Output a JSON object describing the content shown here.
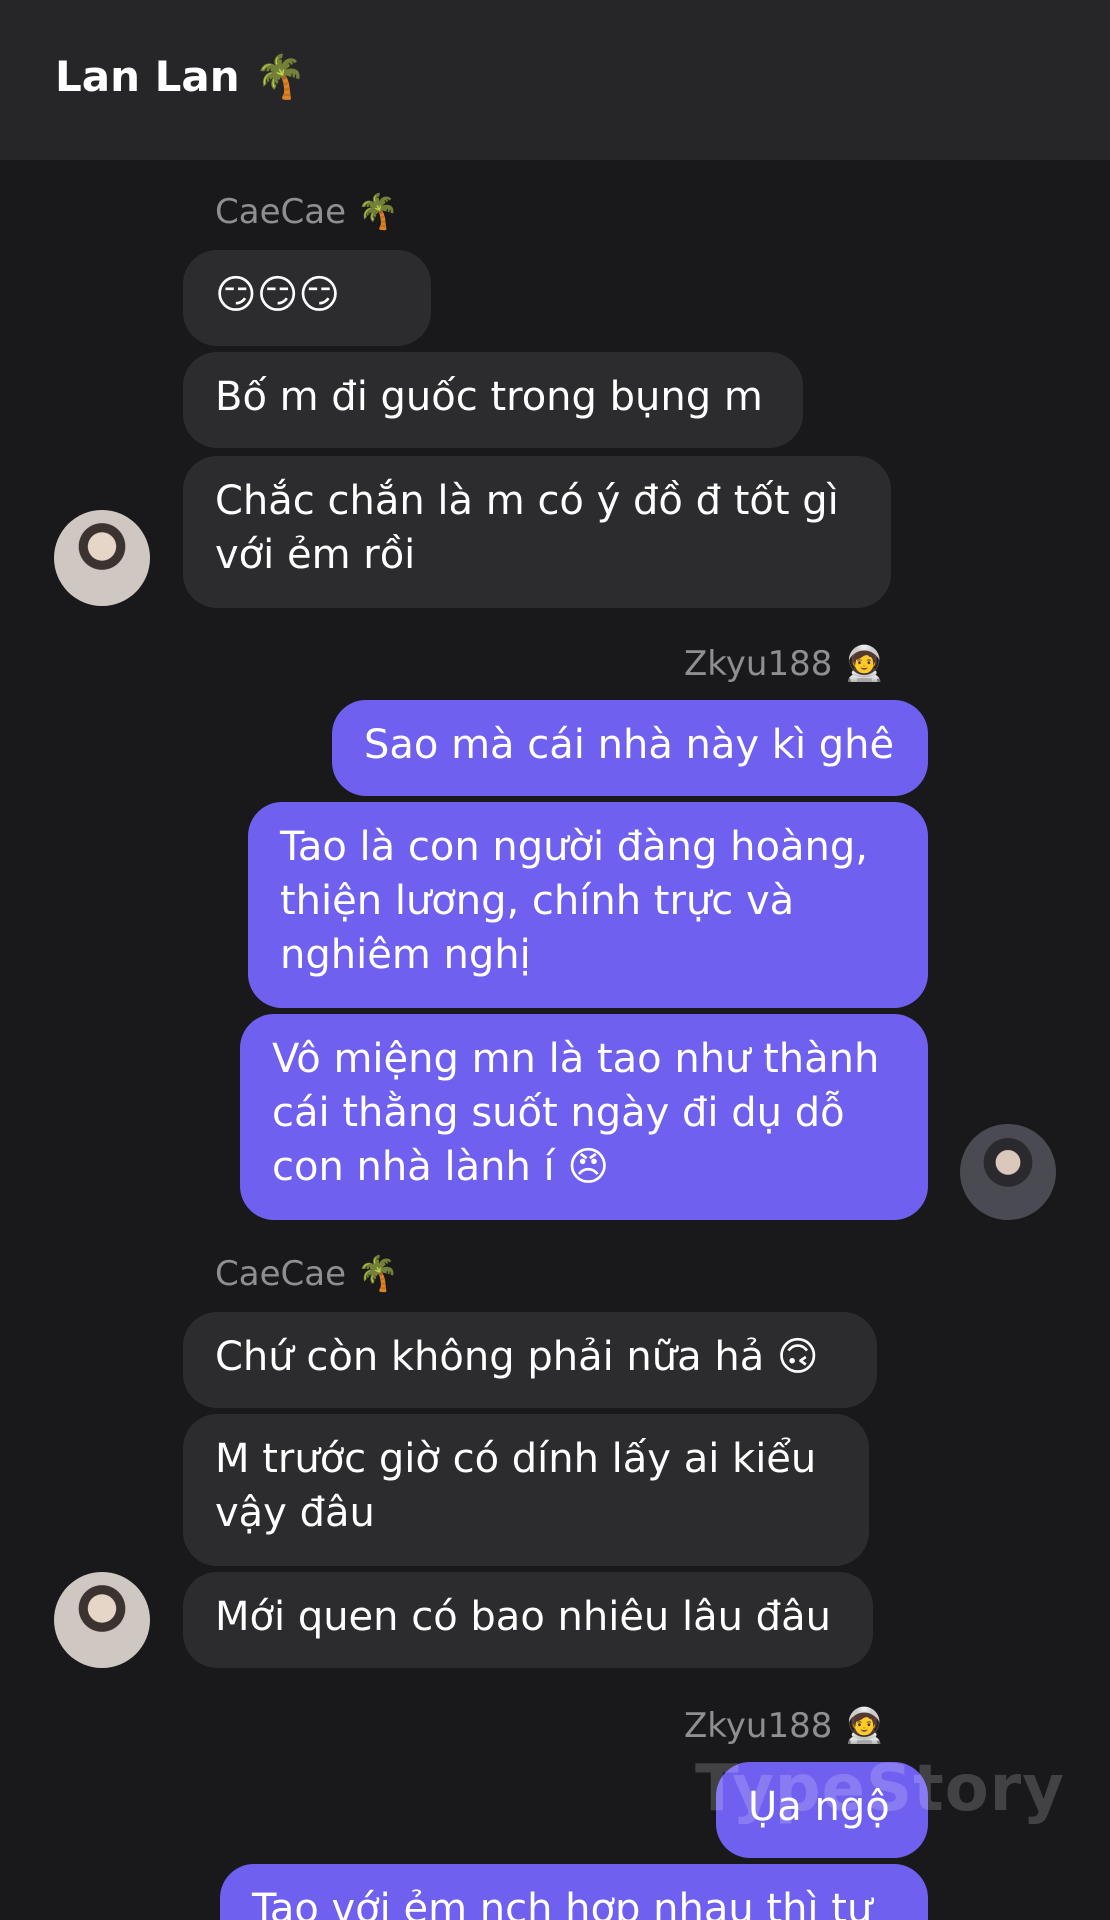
{
  "header": {
    "title": "Lan Lan 🌴"
  },
  "groups": [
    {
      "sender": "CaeCae 🌴",
      "messages": [
        "😏😏😏",
        "Bố m đi guốc trong bụng m",
        "Chắc chắn là m có ý đồ đ tốt gì\nvới ẻm rồi"
      ]
    },
    {
      "sender": "Zkyu188 🧑‍🚀",
      "messages": [
        "Sao mà cái nhà này kì ghê",
        "Tao là con người đàng hoàng,\nthiện lương, chính trực và\nnghiêm nghị",
        "Vô miệng mn là tao như thành\ncái thằng suốt ngày đi dụ dỗ\ncon nhà lành í 😠"
      ]
    },
    {
      "sender": "CaeCae 🌴",
      "messages": [
        "Chứ còn không phải nữa hả 🙃",
        "M trước giờ có dính lấy ai kiểu\nvậy đâu",
        "Mới quen có bao nhiêu lâu đâu"
      ]
    },
    {
      "sender": "Zkyu188 🧑‍🚀",
      "messages": [
        "Ụa ngộ",
        "Tao với ẻm nch hợp nhau thì tự"
      ]
    }
  ],
  "watermark": "TypeStory",
  "colors": {
    "incoming_bubble": "#2c2c2e",
    "outgoing_bubble": "#7060f0",
    "background": "#19191b",
    "header": "#262628"
  }
}
